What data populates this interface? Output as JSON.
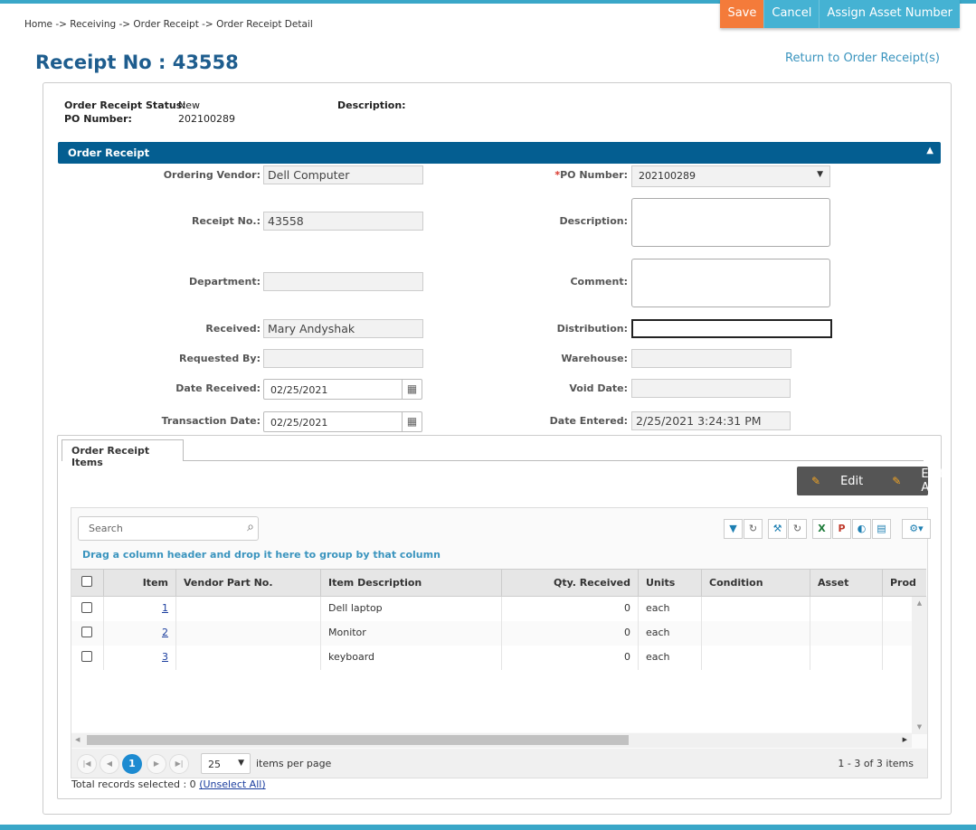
{
  "breadcrumb": "Home -> Receiving -> Order Receipt -> Order Receipt Detail",
  "actions": {
    "save": "Save",
    "cancel": "Cancel",
    "assign": "Assign Asset Number"
  },
  "page_title": "Receipt No : 43558",
  "return_link": "Return to Order Receipt(s)",
  "header": {
    "status_label": "Order Receipt Status:",
    "status_value": "New",
    "po_label": "PO Number:",
    "po_value": "202100289",
    "desc_label": "Description:"
  },
  "section_title": "Order Receipt",
  "form": {
    "vendor_label": "Ordering Vendor",
    "vendor_value": "Dell Computer",
    "receipt_label": "Receipt No.",
    "receipt_value": "43558",
    "dept_label": "Department",
    "dept_value": "",
    "received_label": "Received",
    "received_value": "Mary Andyshak",
    "requested_label": "Requested By",
    "requested_value": "",
    "date_received_label": "Date Received",
    "date_received_value": "02/25/2021",
    "transaction_label": "Transaction Date",
    "transaction_value": "02/25/2021",
    "po_req": "*",
    "po_label": "PO Number",
    "po_value": "202100289",
    "description_label": "Description",
    "comment_label": "Comment",
    "distribution_label": "Distribution",
    "warehouse_label": "Warehouse",
    "void_label": "Void Date",
    "entered_label": "Date Entered",
    "entered_value": "2/25/2021 3:24:31 PM",
    "colon": ":"
  },
  "tab": "Order Receipt Items",
  "edit_bar": {
    "edit": "Edit",
    "edit_all": "Edit All"
  },
  "grid": {
    "search_placeholder": "Search",
    "group_hint": "Drag a column header and drop it here to group by that column",
    "columns": [
      "Item",
      "Vendor Part No.",
      "Item Description",
      "Qty. Received",
      "Units",
      "Condition",
      "Asset",
      "Prod"
    ],
    "rows": [
      {
        "item": "1",
        "vendor_part": "",
        "desc": "Dell laptop",
        "qty": "0",
        "units": "each"
      },
      {
        "item": "2",
        "vendor_part": "",
        "desc": "Monitor",
        "qty": "0",
        "units": "each"
      },
      {
        "item": "3",
        "vendor_part": "",
        "desc": "keyboard",
        "qty": "0",
        "units": "each"
      }
    ],
    "page_current": "1",
    "page_size": "25",
    "items_per_page": "items per page",
    "range_text": "1 - 3 of 3 items"
  },
  "footer": {
    "selected_text": "Total records selected : 0",
    "unselect": "(Unselect All)"
  }
}
